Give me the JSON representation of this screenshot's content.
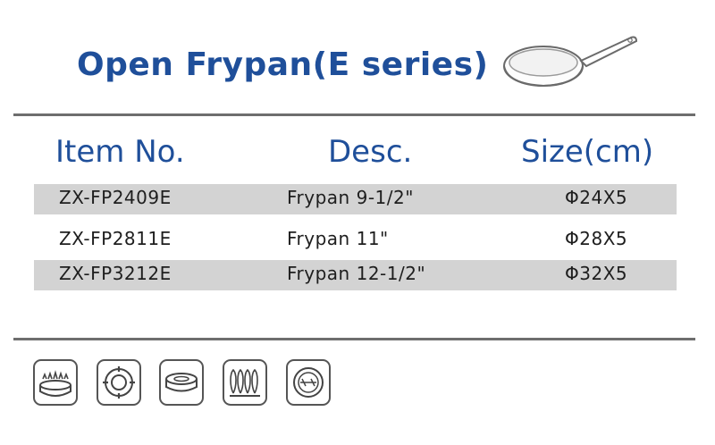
{
  "title": "Open Frypan(E series)",
  "icons": [
    "pan-illustration",
    "gas-stove-icon",
    "electric-plate-icon",
    "ceramic-hob-icon",
    "halogen-coil-icon",
    "induction-icon"
  ],
  "table": {
    "headers": [
      "Item No.",
      "Desc.",
      "Size(cm)"
    ],
    "rows": [
      {
        "item": "ZX-FP2409E",
        "desc": "Frypan 9-1/2\"",
        "size": "Φ24X5"
      },
      {
        "item": "ZX-FP2811E",
        "desc": "Frypan 11\"",
        "size": "Φ28X5"
      },
      {
        "item": "ZX-FP3212E",
        "desc": "Frypan 12-1/2\"",
        "size": "Φ32X5"
      }
    ]
  },
  "colors": {
    "title": "#1f4f9a",
    "rule": "#6e6e6e",
    "row_shade": "#d3d3d3"
  }
}
